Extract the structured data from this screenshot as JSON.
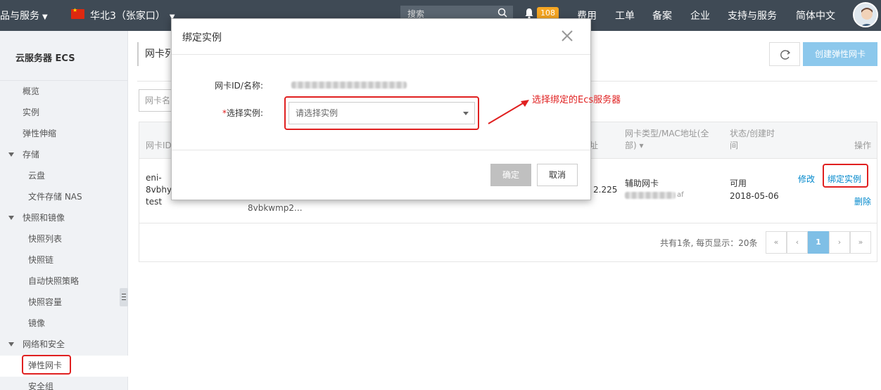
{
  "topbar": {
    "products_label": "品与服务",
    "region_label": "华北3（张家口）",
    "search_placeholder": "搜索",
    "notification_count": "108",
    "nav": [
      "费用",
      "工单",
      "备案",
      "企业",
      "支持与服务",
      "简体中文"
    ],
    "colors": {
      "bar": "#3f4a55",
      "badge": "#f5a623"
    }
  },
  "sidebar": {
    "title": "云服务器 ECS",
    "items": [
      {
        "label": "概览"
      },
      {
        "label": "实例"
      },
      {
        "label": "弹性伸缩"
      },
      {
        "label": "存储"
      },
      {
        "label": "云盘"
      },
      {
        "label": "文件存储 NAS"
      },
      {
        "label": "快照和镜像"
      },
      {
        "label": "快照列表"
      },
      {
        "label": "快照链"
      },
      {
        "label": "自动快照策略"
      },
      {
        "label": "快照容量"
      },
      {
        "label": "镜像"
      },
      {
        "label": "网络和安全"
      },
      {
        "label": "弹性网卡"
      },
      {
        "label": "安全组"
      }
    ]
  },
  "main": {
    "page_title": "网卡列",
    "create_button": "创建弹性网卡",
    "filter_placeholder": "网卡名",
    "table": {
      "headers": {
        "id": "网卡ID/",
        "ip_suffix": "址",
        "type_line1": "网卡类型/MAC地址(全",
        "type_line2": "部) ▾",
        "status_line1": "状态/创建时",
        "status_line2": "间",
        "action": "操作"
      },
      "row": {
        "id_line1": "eni-",
        "id_line2": "8vbhyz",
        "id_line3": "test",
        "instance_id": "8vbkwmp2...",
        "ip": "2.225",
        "type": "辅助网卡",
        "mac_tail": "af",
        "status": "可用",
        "created": "2018-05-06",
        "action_edit": "修改",
        "action_bind": "绑定实例",
        "action_delete": "删除"
      }
    },
    "pager": {
      "info": "共有1条, 每页显示：20条",
      "first": "«",
      "prev": "‹",
      "current": "1",
      "next": "›",
      "last": "»"
    }
  },
  "modal": {
    "title": "绑定实例",
    "nic_label": "网卡ID/名称:",
    "instance_label_req": "*",
    "instance_label": "选择实例:",
    "instance_placeholder": "请选择实例",
    "ok_label": "确定",
    "cancel_label": "取消"
  },
  "annotation": {
    "text": "选择绑定的Ecs服务器",
    "color": "#e02020"
  }
}
